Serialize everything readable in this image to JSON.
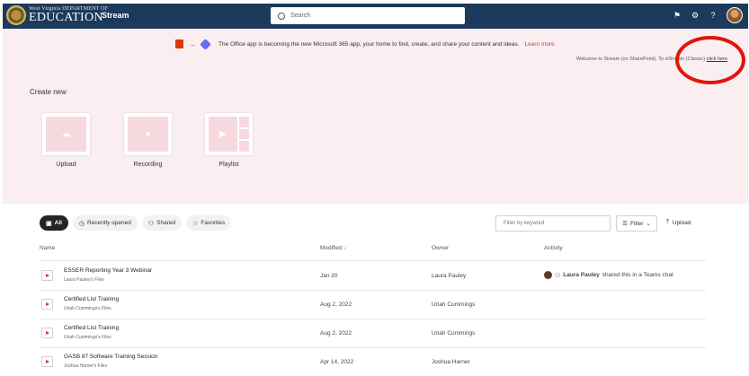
{
  "header": {
    "logo_small": "West Virginia DEPARTMENT OF",
    "logo_big": "EDUCATION",
    "app_name": "Stream",
    "search_placeholder": "Search",
    "icons": [
      "notifications-icon",
      "settings-icon",
      "help-icon"
    ]
  },
  "banner": {
    "message": "The Office app is becoming the new Microsoft 365 app, your home to find, create, and share your content and ideas.",
    "link": "Learn more",
    "close": "×",
    "welcome_prefix": "Welcome to Stream (on SharePoint). To vi",
    "welcome_mid": "Stream (Classic)",
    "welcome_link": "click here"
  },
  "create": {
    "label": "Create new",
    "cards": [
      {
        "label": "Upload",
        "icon": "upload-icon"
      },
      {
        "label": "Recording",
        "icon": "recording-icon"
      },
      {
        "label": "Playlist",
        "icon": "playlist-icon"
      }
    ]
  },
  "filters": {
    "tabs": [
      {
        "label": "All",
        "icon": "all-icon"
      },
      {
        "label": "Recently opened",
        "icon": "clock-icon"
      },
      {
        "label": "Shared",
        "icon": "people-icon"
      },
      {
        "label": "Favorites",
        "icon": "star-icon"
      }
    ],
    "keyword_placeholder": "Filter by keyword",
    "filter_label": "Filter",
    "upload_label": "Upload"
  },
  "table": {
    "columns": {
      "name": "Name",
      "modified": "Modified",
      "modified_sort": "↓",
      "owner": "Owner",
      "activity": "Activity"
    },
    "rows": [
      {
        "title": "ESSER Reporting Year 3 Webinar",
        "sub": "Laura Pauley's Files",
        "modified": "Jan 20",
        "owner": "Laura Pauley",
        "activity_name": "Laura Pauley",
        "activity_text": "shared this in a Teams chat"
      },
      {
        "title": "Certified List Training",
        "sub": "Uriah Cummings's Files",
        "modified": "Aug 2, 2022",
        "owner": "Uriah Cummings",
        "activity_name": "",
        "activity_text": ""
      },
      {
        "title": "Certified List Training",
        "sub": "Uriah Cummings's Files",
        "modified": "Aug 2, 2022",
        "owner": "Uriah Cummings",
        "activity_name": "",
        "activity_text": ""
      },
      {
        "title": "GASB 87 Software Training Session",
        "sub": "Joshua Harner's Files",
        "modified": "Apr 14, 2022",
        "owner": "Joshua Harner",
        "activity_name": "",
        "activity_text": ""
      }
    ]
  },
  "colors": {
    "header_bg": "#1b3a5c",
    "hero_bg": "#fbeef0",
    "accent": "#c4314b",
    "highlight_circle": "#e0150a"
  }
}
